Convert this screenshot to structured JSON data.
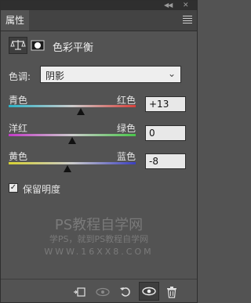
{
  "panel": {
    "tab_label": "属性",
    "title": "色彩平衡"
  },
  "tone": {
    "label": "色调:",
    "selected": "阴影"
  },
  "sliders": [
    {
      "left_label": "青色",
      "right_label": "红色",
      "value": "+13",
      "gradient": [
        "#2bb3c8",
        "#d8403a"
      ]
    },
    {
      "left_label": "洋红",
      "right_label": "绿色",
      "value": "0",
      "gradient": [
        "#c43ac8",
        "#49c64a"
      ]
    },
    {
      "left_label": "黄色",
      "right_label": "蓝色",
      "value": "-8",
      "gradient": [
        "#d6d132",
        "#3b3fc0"
      ]
    }
  ],
  "preserve": {
    "label": "保留明度",
    "checked": true
  },
  "watermark": {
    "line1": "PS教程自学网",
    "line2": "学PS，就到PS教程自学网",
    "line3": "WWW.16XX8.COM"
  },
  "icons": {
    "topbar_collapse": "collapse-arrows-icon",
    "topbar_close": "close-icon",
    "panel_menu": "hamburger-menu-icon",
    "adjustment": "color-balance-scale-icon",
    "mask": "layer-mask-icon",
    "clip": "clip-to-layer-icon",
    "view_previous": "view-previous-state-icon",
    "reset": "reset-icon",
    "visibility": "eye-icon",
    "delete": "trash-icon"
  }
}
